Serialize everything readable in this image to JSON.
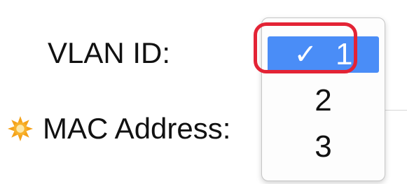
{
  "form": {
    "vlan_label": "VLAN ID:",
    "mac_label": "MAC Address:",
    "required_icon": "required-star-icon"
  },
  "dropdown": {
    "selected_value": "1",
    "options": [
      {
        "label": "1",
        "selected": true,
        "check": "✓"
      },
      {
        "label": "2",
        "selected": false
      },
      {
        "label": "3",
        "selected": false
      }
    ]
  },
  "colors": {
    "selection": "#4a8df7",
    "highlight_box": "#e32335",
    "required_icon": "#f4a21a"
  }
}
